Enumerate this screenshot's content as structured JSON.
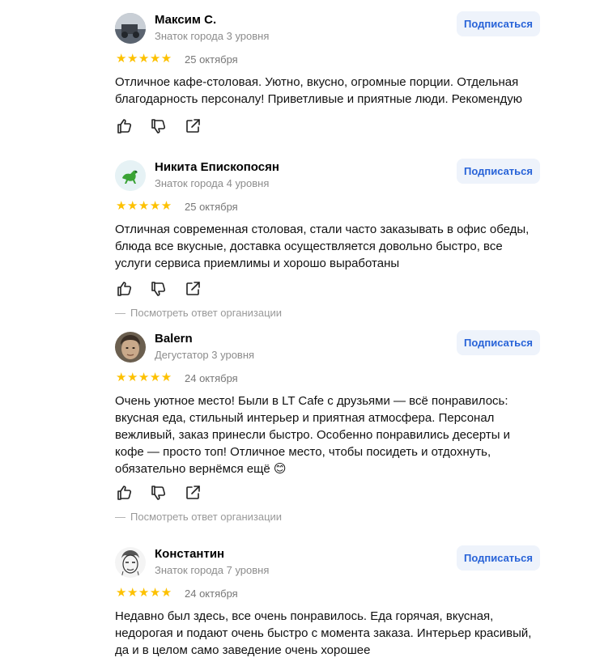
{
  "subscribe_label": "Подписаться",
  "org_reply_dash": "—",
  "org_reply_label": "Посмотреть ответ организации",
  "icons": {
    "like": "thumb-up-icon",
    "dislike": "thumb-down-icon",
    "share": "share-icon"
  },
  "colors": {
    "star": "#fdc100",
    "subscribe_bg": "#eef3fb",
    "subscribe_text": "#2863d8"
  },
  "reviews": [
    {
      "author": "Максим С.",
      "level": "Знаток города 3 уровня",
      "rating": 5,
      "stars": "★★★★★",
      "date": "25 октября",
      "text": "Отличное кафе-столовая. Уютно, вкусно, огромные порции. Отдельная благодарность персоналу! Приветливые и приятные люди. Рекомендую"
    },
    {
      "author": "Никита Епископосян",
      "level": "Знаток города 4 уровня",
      "rating": 5,
      "stars": "★★★★★",
      "date": "25 октября",
      "text": "Отличная современная столовая, стали часто заказывать в офис обеды, блюда все вкусные, доставка осуществляется довольно быстро, все услуги сервиса приемлимы и хорошо выработаны"
    },
    {
      "author": "Balern",
      "level": "Дегустатор 3 уровня",
      "rating": 5,
      "stars": "★★★★★",
      "date": "24 октября",
      "text": "Очень уютное место! Были в LT Cafe с друзьями — всё понравилось: вкусная еда, стильный интерьер и приятная атмосфера. Персонал вежливый, заказ принесли быстро. Особенно понравились десерты и кофе — просто топ! Отличное место, чтобы посидеть и отдохнуть, обязательно вернёмся ещё 😊"
    },
    {
      "author": "Константин",
      "level": "Знаток города 7 уровня",
      "rating": 5,
      "stars": "★★★★★",
      "date": "24 октября",
      "text": "Недавно был здесь, все очень понравилось. Еда горячая, вкусная, недорогая и подают очень быстро с момента заказа. Интерьер красивый, да и в целом само заведение очень хорошее"
    }
  ]
}
